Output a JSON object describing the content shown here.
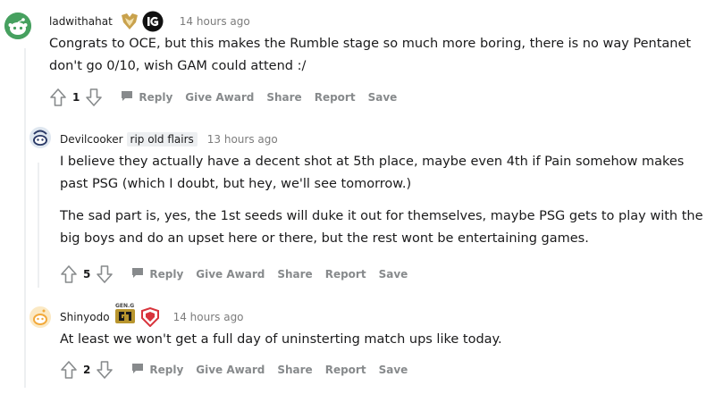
{
  "comments": [
    {
      "username": "ladwithahat",
      "flair": "",
      "time": "14 hours ago",
      "paragraphs": [
        "Congrats to OCE, but this makes the Rumble stage so much more boring, there is no way Pentanet don't go 0/10, wish GAM could attend :/"
      ],
      "score": "1"
    },
    {
      "username": "Devilcooker",
      "flair": "rip old flairs",
      "time": "13 hours ago",
      "paragraphs": [
        "I believe they actually have a decent shot at 5th place, maybe even 4th if Pain somehow makes past PSG (which I doubt, but hey, we'll see tomorrow.)",
        "The sad part is, yes, the 1st seeds will duke it out for themselves, maybe PSG gets to play with the big boys and do an upset here or there, but the rest wont be entertaining games."
      ],
      "score": "5"
    },
    {
      "username": "Shinyodo",
      "flair": "",
      "time": "14 hours ago",
      "paragraphs": [
        "At least we won't get a full day of uninsterting match ups like today."
      ],
      "score": "2"
    }
  ],
  "actions": {
    "reply": "Reply",
    "give_award": "Give Award",
    "share": "Share",
    "report": "Report",
    "save": "Save"
  },
  "flair_badges": {
    "c0_badge1_icon": "rng-team-logo-icon",
    "c0_badge2_icon": "ig-team-logo-icon",
    "c2_badge1_icon": "gen-g-team-logo-icon",
    "c2_badge1_text": "GEN.G",
    "c2_badge2_icon": "lgd-team-logo-icon"
  },
  "colors": {
    "text": "#1a1a1b",
    "muted": "#878a8c",
    "timestamp": "#7c7c7c",
    "flair_bg": "#edeff1",
    "avatar_green": "#46a05f",
    "thread_line": "#edeff1"
  }
}
